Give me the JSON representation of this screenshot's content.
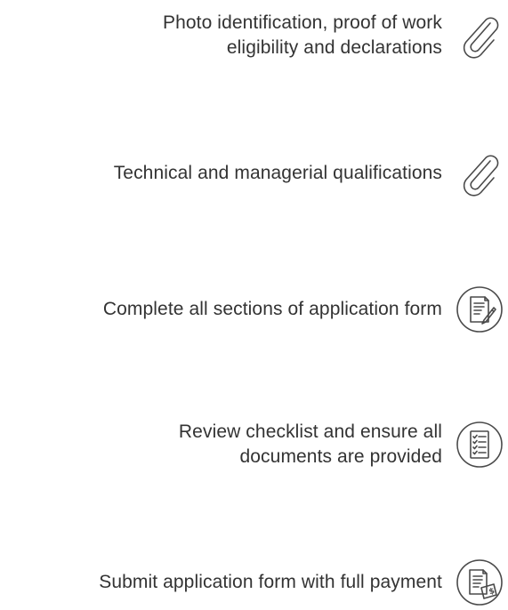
{
  "steps": [
    {
      "lines": [
        "Photo identification, proof of work",
        "eligibility and declarations"
      ],
      "icon": "paperclip-icon"
    },
    {
      "lines": [
        "Technical and managerial qualifications"
      ],
      "icon": "paperclip-icon"
    },
    {
      "lines": [
        "Complete all sections of application form"
      ],
      "icon": "document-edit-icon"
    },
    {
      "lines": [
        "Review checklist and ensure all",
        "documents are provided"
      ],
      "icon": "checklist-icon"
    },
    {
      "lines": [
        "Submit application form with full payment"
      ],
      "icon": "document-payment-icon"
    }
  ],
  "colors": {
    "text": "#333333",
    "icon_stroke": "#4a4a4a"
  }
}
